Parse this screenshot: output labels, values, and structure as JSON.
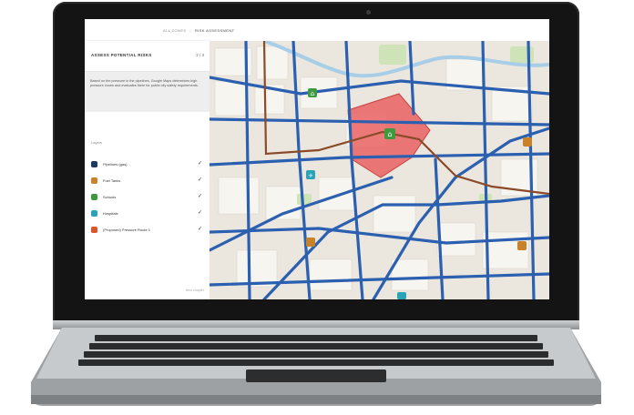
{
  "app": {
    "breadcrumb_root": "ALL ZONES",
    "breadcrumb_current": "RISK ASSESSMENT"
  },
  "panel": {
    "title": "ASSESS POTENTIAL RISKS",
    "count": "2 / 3",
    "description": "Based on the pressure in the pipelines, Google Maps determines high pressure zones and evaluates them for public city safety requirements.",
    "layers_label": "Layers",
    "layers": [
      {
        "label": "Pipelines (gas)",
        "color": "#1f3a5f",
        "icon": "pipeline-icon",
        "checked": "✓"
      },
      {
        "label": "Fuel Tanks",
        "color": "#c8822a",
        "icon": "fuel-tank-icon",
        "checked": "✓"
      },
      {
        "label": "Schools",
        "color": "#3f9a3f",
        "icon": "school-icon",
        "checked": "✓"
      },
      {
        "label": "Hospitals",
        "color": "#2aa3b8",
        "icon": "hospital-icon",
        "checked": "✓"
      },
      {
        "label": "(Proposed) Pressure Route 1",
        "color": "#d9572f",
        "icon": "route-icon",
        "checked": "✓"
      }
    ],
    "footer": "Next chapter"
  },
  "map": {
    "road_color": "#2b5fb0",
    "pipeline_color": "#8a4b2a",
    "risk_zone_color": "#e85a5a",
    "markers": [
      {
        "type": "school",
        "icon": "school-icon",
        "color": "#3f9a3f"
      },
      {
        "type": "school",
        "icon": "school-icon",
        "color": "#3f9a3f"
      },
      {
        "type": "hospital",
        "icon": "hospital-icon",
        "color": "#2aa3b8"
      },
      {
        "type": "hospital",
        "icon": "hospital-icon",
        "color": "#2aa3b8"
      },
      {
        "type": "fuel-tank",
        "icon": "fuel-tank-icon",
        "color": "#c8822a"
      },
      {
        "type": "fuel-tank",
        "icon": "fuel-tank-icon",
        "color": "#c8822a"
      },
      {
        "type": "fuel-tank",
        "icon": "fuel-tank-icon",
        "color": "#c8822a"
      }
    ]
  }
}
